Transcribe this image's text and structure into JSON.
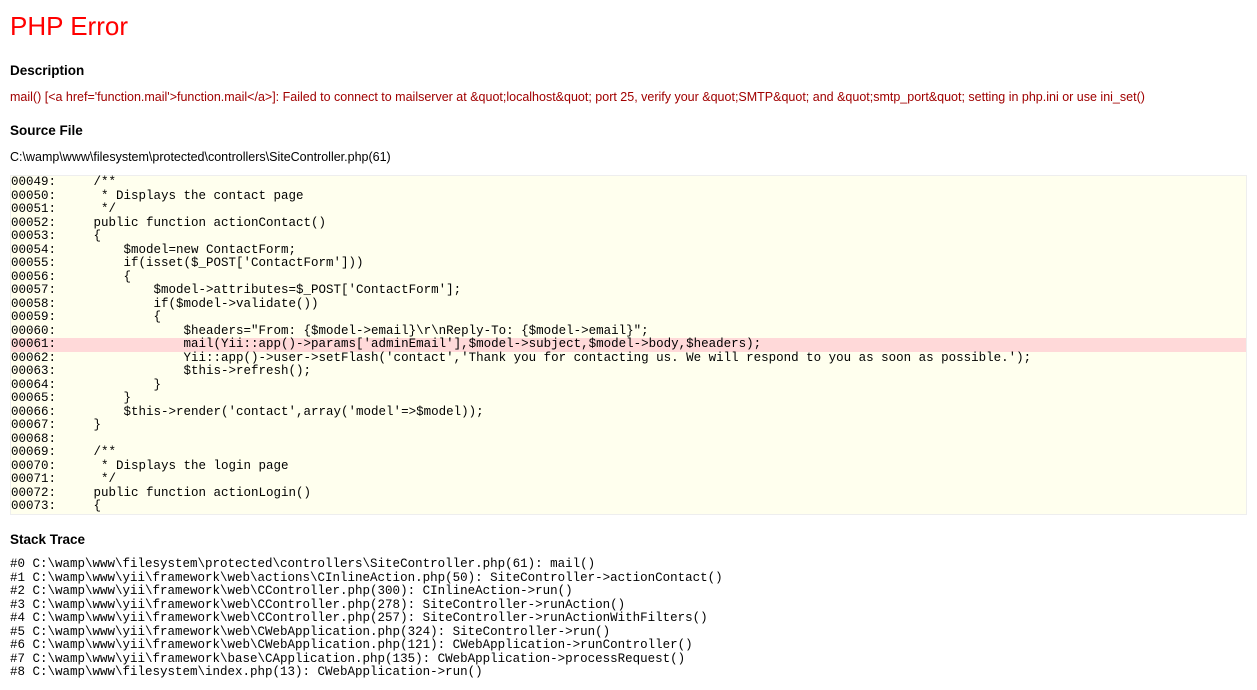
{
  "title": "PHP Error",
  "description_heading": "Description",
  "error_message": "mail() [<a href='function.mail'>function.mail</a>]: Failed to connect to mailserver at &quot;localhost&quot; port 25, verify your &quot;SMTP&quot; and &quot;smtp_port&quot; setting in php.ini or use ini_set()",
  "sourcefile_heading": "Source File",
  "sourcefile_path": "C:\\wamp\\www\\filesystem\\protected\\controllers\\SiteController.php(61)",
  "source_lines": [
    {
      "n": "00049",
      "t": "    /**"
    },
    {
      "n": "00050",
      "t": "     * Displays the contact page"
    },
    {
      "n": "00051",
      "t": "     */"
    },
    {
      "n": "00052",
      "t": "    public function actionContact()"
    },
    {
      "n": "00053",
      "t": "    {"
    },
    {
      "n": "00054",
      "t": "        $model=new ContactForm;"
    },
    {
      "n": "00055",
      "t": "        if(isset($_POST['ContactForm']))"
    },
    {
      "n": "00056",
      "t": "        {"
    },
    {
      "n": "00057",
      "t": "            $model->attributes=$_POST['ContactForm'];"
    },
    {
      "n": "00058",
      "t": "            if($model->validate())"
    },
    {
      "n": "00059",
      "t": "            {"
    },
    {
      "n": "00060",
      "t": "                $headers=\"From: {$model->email}\\r\\nReply-To: {$model->email}\";"
    },
    {
      "n": "00061",
      "t": "                mail(Yii::app()->params['adminEmail'],$model->subject,$model->body,$headers);",
      "err": true
    },
    {
      "n": "00062",
      "t": "                Yii::app()->user->setFlash('contact','Thank you for contacting us. We will respond to you as soon as possible.');"
    },
    {
      "n": "00063",
      "t": "                $this->refresh();"
    },
    {
      "n": "00064",
      "t": "            }"
    },
    {
      "n": "00065",
      "t": "        }"
    },
    {
      "n": "00066",
      "t": "        $this->render('contact',array('model'=>$model));"
    },
    {
      "n": "00067",
      "t": "    }"
    },
    {
      "n": "00068",
      "t": ""
    },
    {
      "n": "00069",
      "t": "    /**"
    },
    {
      "n": "00070",
      "t": "     * Displays the login page"
    },
    {
      "n": "00071",
      "t": "     */"
    },
    {
      "n": "00072",
      "t": "    public function actionLogin()"
    },
    {
      "n": "00073",
      "t": "    {"
    }
  ],
  "stacktrace_heading": "Stack Trace",
  "stack_lines": [
    "#0 C:\\wamp\\www\\filesystem\\protected\\controllers\\SiteController.php(61): mail()",
    "#1 C:\\wamp\\www\\yii\\framework\\web\\actions\\CInlineAction.php(50): SiteController->actionContact()",
    "#2 C:\\wamp\\www\\yii\\framework\\web\\CController.php(300): CInlineAction->run()",
    "#3 C:\\wamp\\www\\yii\\framework\\web\\CController.php(278): SiteController->runAction()",
    "#4 C:\\wamp\\www\\yii\\framework\\web\\CController.php(257): SiteController->runActionWithFilters()",
    "#5 C:\\wamp\\www\\yii\\framework\\web\\CWebApplication.php(324): SiteController->run()",
    "#6 C:\\wamp\\www\\yii\\framework\\web\\CWebApplication.php(121): CWebApplication->runController()",
    "#7 C:\\wamp\\www\\yii\\framework\\base\\CApplication.php(135): CWebApplication->processRequest()",
    "#8 C:\\wamp\\www\\filesystem\\index.php(13): CWebApplication->run()"
  ]
}
